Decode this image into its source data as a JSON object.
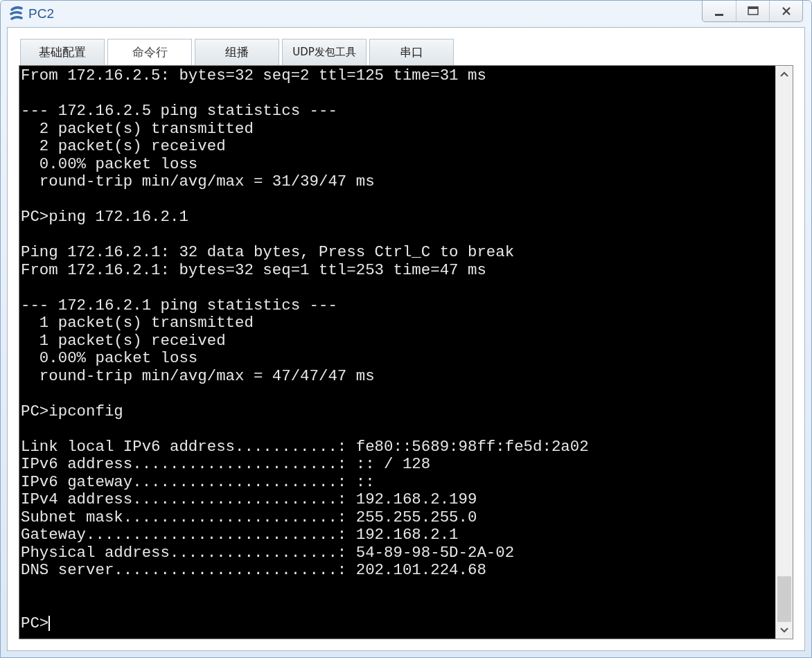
{
  "window": {
    "title": "PC2"
  },
  "tabs": [
    {
      "label": "基础配置",
      "selected": false
    },
    {
      "label": "命令行",
      "selected": true
    },
    {
      "label": "组播",
      "selected": false
    },
    {
      "label": "UDP发包工具",
      "selected": false
    },
    {
      "label": "串口",
      "selected": false
    }
  ],
  "terminal": {
    "lines": [
      {
        "kind": "text",
        "text": "From 172.16.2.5: bytes=32 seq=2 ttl=125 time=31 ms"
      },
      {
        "kind": "blank"
      },
      {
        "kind": "text",
        "text": "--- 172.16.2.5 ping statistics ---"
      },
      {
        "kind": "text",
        "text": "  2 packet(s) transmitted"
      },
      {
        "kind": "text",
        "text": "  2 packet(s) received"
      },
      {
        "kind": "text",
        "text": "  0.00% packet loss"
      },
      {
        "kind": "text",
        "text": "  round-trip min/avg/max = 31/39/47 ms"
      },
      {
        "kind": "blank"
      },
      {
        "kind": "text",
        "text": "PC>ping 172.16.2.1"
      },
      {
        "kind": "blank"
      },
      {
        "kind": "text",
        "text": "Ping 172.16.2.1: 32 data bytes, Press Ctrl_C to break"
      },
      {
        "kind": "text",
        "text": "From 172.16.2.1: bytes=32 seq=1 ttl=253 time=47 ms"
      },
      {
        "kind": "blank"
      },
      {
        "kind": "text",
        "text": "--- 172.16.2.1 ping statistics ---"
      },
      {
        "kind": "text",
        "text": "  1 packet(s) transmitted"
      },
      {
        "kind": "text",
        "text": "  1 packet(s) received"
      },
      {
        "kind": "text",
        "text": "  0.00% packet loss"
      },
      {
        "kind": "text",
        "text": "  round-trip min/avg/max = 47/47/47 ms"
      },
      {
        "kind": "blank"
      },
      {
        "kind": "text",
        "text": "PC>ipconfig"
      },
      {
        "kind": "blank"
      },
      {
        "kind": "text",
        "text": "Link local IPv6 address...........: fe80::5689:98ff:fe5d:2a02"
      },
      {
        "kind": "text",
        "text": "IPv6 address......................: :: / 128"
      },
      {
        "kind": "text",
        "text": "IPv6 gateway......................: ::"
      },
      {
        "kind": "text",
        "text": "IPv4 address......................: 192.168.2.199"
      },
      {
        "kind": "text",
        "text": "Subnet mask.......................: 255.255.255.0"
      },
      {
        "kind": "text",
        "text": "Gateway...........................: 192.168.2.1"
      },
      {
        "kind": "text",
        "text": "Physical address..................: 54-89-98-5D-2A-02"
      },
      {
        "kind": "text",
        "text": "DNS server........................: 202.101.224.68"
      },
      {
        "kind": "blank"
      },
      {
        "kind": "blank"
      },
      {
        "kind": "prompt",
        "text": "PC>"
      }
    ]
  }
}
